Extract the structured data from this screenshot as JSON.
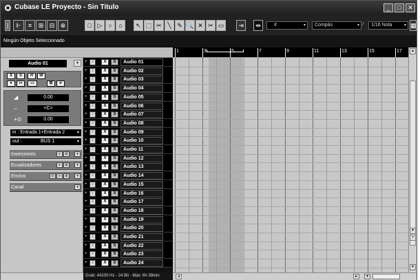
{
  "window": {
    "title": "Cubase LE Proyecto - Sin Titulo",
    "controls": [
      "_",
      "□",
      "✕"
    ]
  },
  "toolbar": {
    "buttons_left": [
      "|",
      "⊩",
      "≡",
      "⊞",
      "⊟",
      "⊕"
    ],
    "transport": [
      "□",
      "▷",
      "○",
      "⌂"
    ],
    "tools": [
      "↖",
      "⬚",
      "✂",
      "╲",
      "✎",
      "🔍",
      "✕",
      "✂",
      "▭"
    ],
    "snap_field": "",
    "grid_symbol": "#",
    "grid_type": "Compás",
    "quantize_symbol": "⁄",
    "quantize_value": "1/16 Nota"
  },
  "infoline": {
    "text": "Ningún Objeto Seleccionado"
  },
  "inspector": {
    "track_name": "Audio 01",
    "row1_buttons": [
      "X",
      "S",
      "R",
      "W"
    ],
    "row2_buttons": [
      "●",
      "↦",
      "▭",
      "⊞",
      "e"
    ],
    "volume": "0.00",
    "pan": "<C>",
    "delay": "0.00",
    "input": "in :  Entrada 1+Entrada 2",
    "output_label": "out :",
    "output": "BUS 1",
    "sections": [
      "Inserciones",
      "Ecualizadores",
      "Envíos",
      "Canal"
    ]
  },
  "tracks": [
    "Audio 01",
    "Audio 02",
    "Audio 03",
    "Audio 04",
    "Audio 05",
    "Audio 06",
    "Audio 07",
    "Audio 08",
    "Audio 09",
    "Audio 10",
    "Audio 11",
    "Audio 12",
    "Audio 13",
    "Audio 14",
    "Audio 15",
    "Audio 16",
    "Audio 17",
    "Audio 18",
    "Audio 19",
    "Audio 20",
    "Audio 21",
    "Audio 22",
    "Audio 23",
    "Audio 24"
  ],
  "track_buttons": {
    "mute": "X",
    "solo": "S"
  },
  "ruler": {
    "bars": [
      "1",
      "3",
      "5",
      "7",
      "9",
      "11",
      "13",
      "15",
      "17"
    ]
  },
  "statusbar": {
    "text": "Grab: 44100 Hz - 24 Bit - Máx: 6h 38min"
  }
}
